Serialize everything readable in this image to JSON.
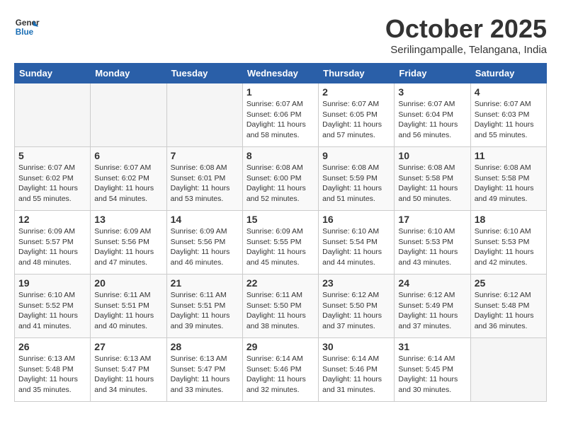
{
  "header": {
    "logo_line1": "General",
    "logo_line2": "Blue",
    "month": "October 2025",
    "location": "Serilingampalle, Telangana, India"
  },
  "days_of_week": [
    "Sunday",
    "Monday",
    "Tuesday",
    "Wednesday",
    "Thursday",
    "Friday",
    "Saturday"
  ],
  "weeks": [
    [
      {
        "day": "",
        "info": ""
      },
      {
        "day": "",
        "info": ""
      },
      {
        "day": "",
        "info": ""
      },
      {
        "day": "1",
        "info": "Sunrise: 6:07 AM\nSunset: 6:06 PM\nDaylight: 11 hours\nand 58 minutes."
      },
      {
        "day": "2",
        "info": "Sunrise: 6:07 AM\nSunset: 6:05 PM\nDaylight: 11 hours\nand 57 minutes."
      },
      {
        "day": "3",
        "info": "Sunrise: 6:07 AM\nSunset: 6:04 PM\nDaylight: 11 hours\nand 56 minutes."
      },
      {
        "day": "4",
        "info": "Sunrise: 6:07 AM\nSunset: 6:03 PM\nDaylight: 11 hours\nand 55 minutes."
      }
    ],
    [
      {
        "day": "5",
        "info": "Sunrise: 6:07 AM\nSunset: 6:02 PM\nDaylight: 11 hours\nand 55 minutes."
      },
      {
        "day": "6",
        "info": "Sunrise: 6:07 AM\nSunset: 6:02 PM\nDaylight: 11 hours\nand 54 minutes."
      },
      {
        "day": "7",
        "info": "Sunrise: 6:08 AM\nSunset: 6:01 PM\nDaylight: 11 hours\nand 53 minutes."
      },
      {
        "day": "8",
        "info": "Sunrise: 6:08 AM\nSunset: 6:00 PM\nDaylight: 11 hours\nand 52 minutes."
      },
      {
        "day": "9",
        "info": "Sunrise: 6:08 AM\nSunset: 5:59 PM\nDaylight: 11 hours\nand 51 minutes."
      },
      {
        "day": "10",
        "info": "Sunrise: 6:08 AM\nSunset: 5:58 PM\nDaylight: 11 hours\nand 50 minutes."
      },
      {
        "day": "11",
        "info": "Sunrise: 6:08 AM\nSunset: 5:58 PM\nDaylight: 11 hours\nand 49 minutes."
      }
    ],
    [
      {
        "day": "12",
        "info": "Sunrise: 6:09 AM\nSunset: 5:57 PM\nDaylight: 11 hours\nand 48 minutes."
      },
      {
        "day": "13",
        "info": "Sunrise: 6:09 AM\nSunset: 5:56 PM\nDaylight: 11 hours\nand 47 minutes."
      },
      {
        "day": "14",
        "info": "Sunrise: 6:09 AM\nSunset: 5:56 PM\nDaylight: 11 hours\nand 46 minutes."
      },
      {
        "day": "15",
        "info": "Sunrise: 6:09 AM\nSunset: 5:55 PM\nDaylight: 11 hours\nand 45 minutes."
      },
      {
        "day": "16",
        "info": "Sunrise: 6:10 AM\nSunset: 5:54 PM\nDaylight: 11 hours\nand 44 minutes."
      },
      {
        "day": "17",
        "info": "Sunrise: 6:10 AM\nSunset: 5:53 PM\nDaylight: 11 hours\nand 43 minutes."
      },
      {
        "day": "18",
        "info": "Sunrise: 6:10 AM\nSunset: 5:53 PM\nDaylight: 11 hours\nand 42 minutes."
      }
    ],
    [
      {
        "day": "19",
        "info": "Sunrise: 6:10 AM\nSunset: 5:52 PM\nDaylight: 11 hours\nand 41 minutes."
      },
      {
        "day": "20",
        "info": "Sunrise: 6:11 AM\nSunset: 5:51 PM\nDaylight: 11 hours\nand 40 minutes."
      },
      {
        "day": "21",
        "info": "Sunrise: 6:11 AM\nSunset: 5:51 PM\nDaylight: 11 hours\nand 39 minutes."
      },
      {
        "day": "22",
        "info": "Sunrise: 6:11 AM\nSunset: 5:50 PM\nDaylight: 11 hours\nand 38 minutes."
      },
      {
        "day": "23",
        "info": "Sunrise: 6:12 AM\nSunset: 5:50 PM\nDaylight: 11 hours\nand 37 minutes."
      },
      {
        "day": "24",
        "info": "Sunrise: 6:12 AM\nSunset: 5:49 PM\nDaylight: 11 hours\nand 37 minutes."
      },
      {
        "day": "25",
        "info": "Sunrise: 6:12 AM\nSunset: 5:48 PM\nDaylight: 11 hours\nand 36 minutes."
      }
    ],
    [
      {
        "day": "26",
        "info": "Sunrise: 6:13 AM\nSunset: 5:48 PM\nDaylight: 11 hours\nand 35 minutes."
      },
      {
        "day": "27",
        "info": "Sunrise: 6:13 AM\nSunset: 5:47 PM\nDaylight: 11 hours\nand 34 minutes."
      },
      {
        "day": "28",
        "info": "Sunrise: 6:13 AM\nSunset: 5:47 PM\nDaylight: 11 hours\nand 33 minutes."
      },
      {
        "day": "29",
        "info": "Sunrise: 6:14 AM\nSunset: 5:46 PM\nDaylight: 11 hours\nand 32 minutes."
      },
      {
        "day": "30",
        "info": "Sunrise: 6:14 AM\nSunset: 5:46 PM\nDaylight: 11 hours\nand 31 minutes."
      },
      {
        "day": "31",
        "info": "Sunrise: 6:14 AM\nSunset: 5:45 PM\nDaylight: 11 hours\nand 30 minutes."
      },
      {
        "day": "",
        "info": ""
      }
    ]
  ]
}
